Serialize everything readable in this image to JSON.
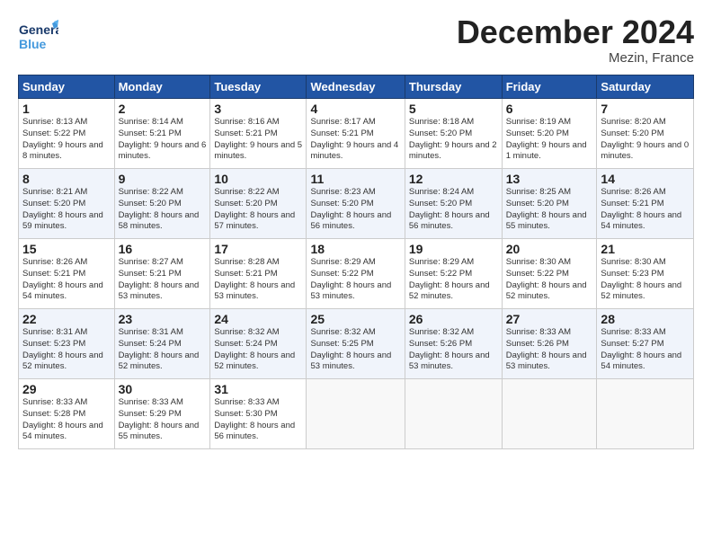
{
  "header": {
    "logo_general": "General",
    "logo_blue": "Blue",
    "month": "December 2024",
    "location": "Mezin, France"
  },
  "weekdays": [
    "Sunday",
    "Monday",
    "Tuesday",
    "Wednesday",
    "Thursday",
    "Friday",
    "Saturday"
  ],
  "weeks": [
    [
      {
        "day": "1",
        "sunrise": "8:13 AM",
        "sunset": "5:22 PM",
        "daylight": "9 hours and 8 minutes."
      },
      {
        "day": "2",
        "sunrise": "8:14 AM",
        "sunset": "5:21 PM",
        "daylight": "9 hours and 6 minutes."
      },
      {
        "day": "3",
        "sunrise": "8:16 AM",
        "sunset": "5:21 PM",
        "daylight": "9 hours and 5 minutes."
      },
      {
        "day": "4",
        "sunrise": "8:17 AM",
        "sunset": "5:21 PM",
        "daylight": "9 hours and 4 minutes."
      },
      {
        "day": "5",
        "sunrise": "8:18 AM",
        "sunset": "5:20 PM",
        "daylight": "9 hours and 2 minutes."
      },
      {
        "day": "6",
        "sunrise": "8:19 AM",
        "sunset": "5:20 PM",
        "daylight": "9 hours and 1 minute."
      },
      {
        "day": "7",
        "sunrise": "8:20 AM",
        "sunset": "5:20 PM",
        "daylight": "9 hours and 0 minutes."
      }
    ],
    [
      {
        "day": "8",
        "sunrise": "8:21 AM",
        "sunset": "5:20 PM",
        "daylight": "8 hours and 59 minutes."
      },
      {
        "day": "9",
        "sunrise": "8:22 AM",
        "sunset": "5:20 PM",
        "daylight": "8 hours and 58 minutes."
      },
      {
        "day": "10",
        "sunrise": "8:22 AM",
        "sunset": "5:20 PM",
        "daylight": "8 hours and 57 minutes."
      },
      {
        "day": "11",
        "sunrise": "8:23 AM",
        "sunset": "5:20 PM",
        "daylight": "8 hours and 56 minutes."
      },
      {
        "day": "12",
        "sunrise": "8:24 AM",
        "sunset": "5:20 PM",
        "daylight": "8 hours and 56 minutes."
      },
      {
        "day": "13",
        "sunrise": "8:25 AM",
        "sunset": "5:20 PM",
        "daylight": "8 hours and 55 minutes."
      },
      {
        "day": "14",
        "sunrise": "8:26 AM",
        "sunset": "5:21 PM",
        "daylight": "8 hours and 54 minutes."
      }
    ],
    [
      {
        "day": "15",
        "sunrise": "8:26 AM",
        "sunset": "5:21 PM",
        "daylight": "8 hours and 54 minutes."
      },
      {
        "day": "16",
        "sunrise": "8:27 AM",
        "sunset": "5:21 PM",
        "daylight": "8 hours and 53 minutes."
      },
      {
        "day": "17",
        "sunrise": "8:28 AM",
        "sunset": "5:21 PM",
        "daylight": "8 hours and 53 minutes."
      },
      {
        "day": "18",
        "sunrise": "8:29 AM",
        "sunset": "5:22 PM",
        "daylight": "8 hours and 53 minutes."
      },
      {
        "day": "19",
        "sunrise": "8:29 AM",
        "sunset": "5:22 PM",
        "daylight": "8 hours and 52 minutes."
      },
      {
        "day": "20",
        "sunrise": "8:30 AM",
        "sunset": "5:22 PM",
        "daylight": "8 hours and 52 minutes."
      },
      {
        "day": "21",
        "sunrise": "8:30 AM",
        "sunset": "5:23 PM",
        "daylight": "8 hours and 52 minutes."
      }
    ],
    [
      {
        "day": "22",
        "sunrise": "8:31 AM",
        "sunset": "5:23 PM",
        "daylight": "8 hours and 52 minutes."
      },
      {
        "day": "23",
        "sunrise": "8:31 AM",
        "sunset": "5:24 PM",
        "daylight": "8 hours and 52 minutes."
      },
      {
        "day": "24",
        "sunrise": "8:32 AM",
        "sunset": "5:24 PM",
        "daylight": "8 hours and 52 minutes."
      },
      {
        "day": "25",
        "sunrise": "8:32 AM",
        "sunset": "5:25 PM",
        "daylight": "8 hours and 53 minutes."
      },
      {
        "day": "26",
        "sunrise": "8:32 AM",
        "sunset": "5:26 PM",
        "daylight": "8 hours and 53 minutes."
      },
      {
        "day": "27",
        "sunrise": "8:33 AM",
        "sunset": "5:26 PM",
        "daylight": "8 hours and 53 minutes."
      },
      {
        "day": "28",
        "sunrise": "8:33 AM",
        "sunset": "5:27 PM",
        "daylight": "8 hours and 54 minutes."
      }
    ],
    [
      {
        "day": "29",
        "sunrise": "8:33 AM",
        "sunset": "5:28 PM",
        "daylight": "8 hours and 54 minutes."
      },
      {
        "day": "30",
        "sunrise": "8:33 AM",
        "sunset": "5:29 PM",
        "daylight": "8 hours and 55 minutes."
      },
      {
        "day": "31",
        "sunrise": "8:33 AM",
        "sunset": "5:30 PM",
        "daylight": "8 hours and 56 minutes."
      },
      null,
      null,
      null,
      null
    ]
  ]
}
